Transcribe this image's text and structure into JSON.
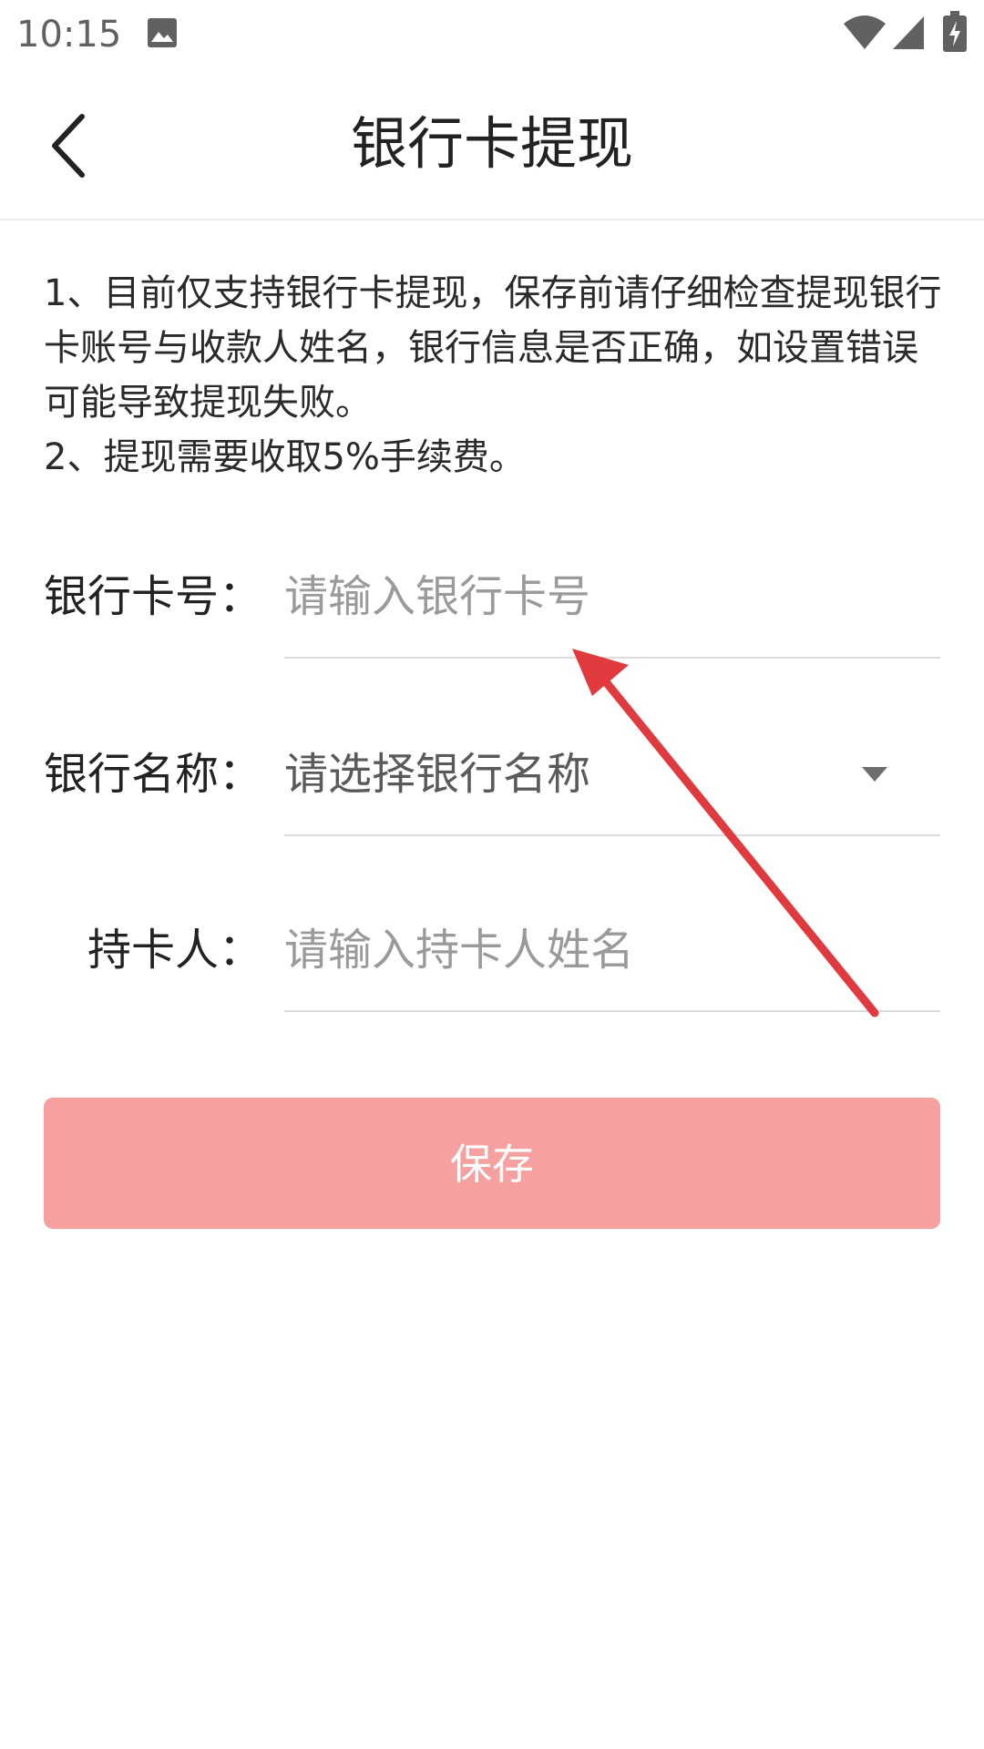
{
  "status_bar": {
    "time": "10:15",
    "icons": [
      "gallery-icon",
      "wifi-icon",
      "signal-icon",
      "battery-charging-icon"
    ]
  },
  "header": {
    "title": "银行卡提现",
    "back_icon": "chevron-left-icon"
  },
  "notice": {
    "line1": "1、目前仅支持银行卡提现，保存前请仔细检查提现银行卡账号与收款人姓名，银行信息是否正确，如设置错误可能导致提现失败。",
    "line2": "2、提现需要收取5%手续费。"
  },
  "form": {
    "card_number": {
      "label": "银行卡号：",
      "placeholder": "请输入银行卡号",
      "value": ""
    },
    "bank_name": {
      "label": "银行名称：",
      "selected": "请选择银行名称",
      "icon": "dropdown-triangle-icon"
    },
    "holder": {
      "label": "持卡人：",
      "placeholder": "请输入持卡人姓名",
      "value": ""
    }
  },
  "save_button": {
    "label": "保存",
    "color": "#f6a1a0"
  },
  "annotation": {
    "arrow_color": "#e0393e"
  }
}
